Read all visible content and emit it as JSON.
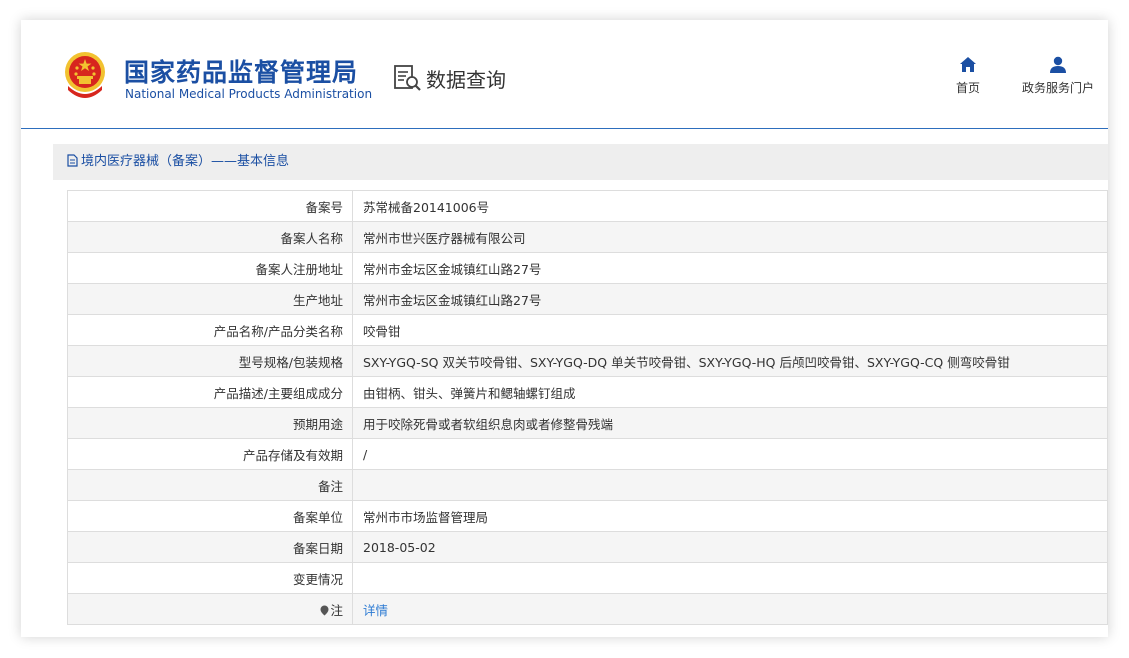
{
  "header": {
    "brand_cn": "国家药品监督管理局",
    "brand_en": "National Medical Products Administration",
    "query_label": "数据查询",
    "nav": [
      {
        "label": "首页",
        "icon": "home-icon"
      },
      {
        "label": "政务服务门户",
        "icon": "user-icon"
      }
    ]
  },
  "panel": {
    "title": "境内医疗器械（备案）——基本信息"
  },
  "record": {
    "rows": [
      {
        "key": "备案号",
        "value": "苏常械备20141006号"
      },
      {
        "key": "备案人名称",
        "value": "常州市世兴医疗器械有限公司"
      },
      {
        "key": "备案人注册地址",
        "value": "常州市金坛区金城镇红山路27号"
      },
      {
        "key": "生产地址",
        "value": "常州市金坛区金城镇红山路27号"
      },
      {
        "key": "产品名称/产品分类名称",
        "value": "咬骨钳"
      },
      {
        "key": "型号规格/包装规格",
        "value": "SXY-YGQ-SQ 双关节咬骨钳、SXY-YGQ-DQ 单关节咬骨钳、SXY-YGQ-HQ 后颅凹咬骨钳、SXY-YGQ-CQ 侧弯咬骨钳"
      },
      {
        "key": "产品描述/主要组成成分",
        "value": "由钳柄、钳头、弹簧片和鳃轴螺钉组成"
      },
      {
        "key": "预期用途",
        "value": "用于咬除死骨或者软组织息肉或者修整骨残端"
      },
      {
        "key": "产品存储及有效期",
        "value": "/"
      },
      {
        "key": "备注",
        "value": ""
      },
      {
        "key": "备案单位",
        "value": "常州市市场监督管理局"
      },
      {
        "key": "备案日期",
        "value": "2018-05-02"
      },
      {
        "key": "变更情况",
        "value": ""
      }
    ],
    "note_key": "注",
    "note_link": "详情"
  },
  "colors": {
    "brand_blue": "#1b4fa3",
    "link_blue": "#2d7bd3",
    "emblem_red": "#d7261e",
    "emblem_gold": "#f2c230"
  }
}
